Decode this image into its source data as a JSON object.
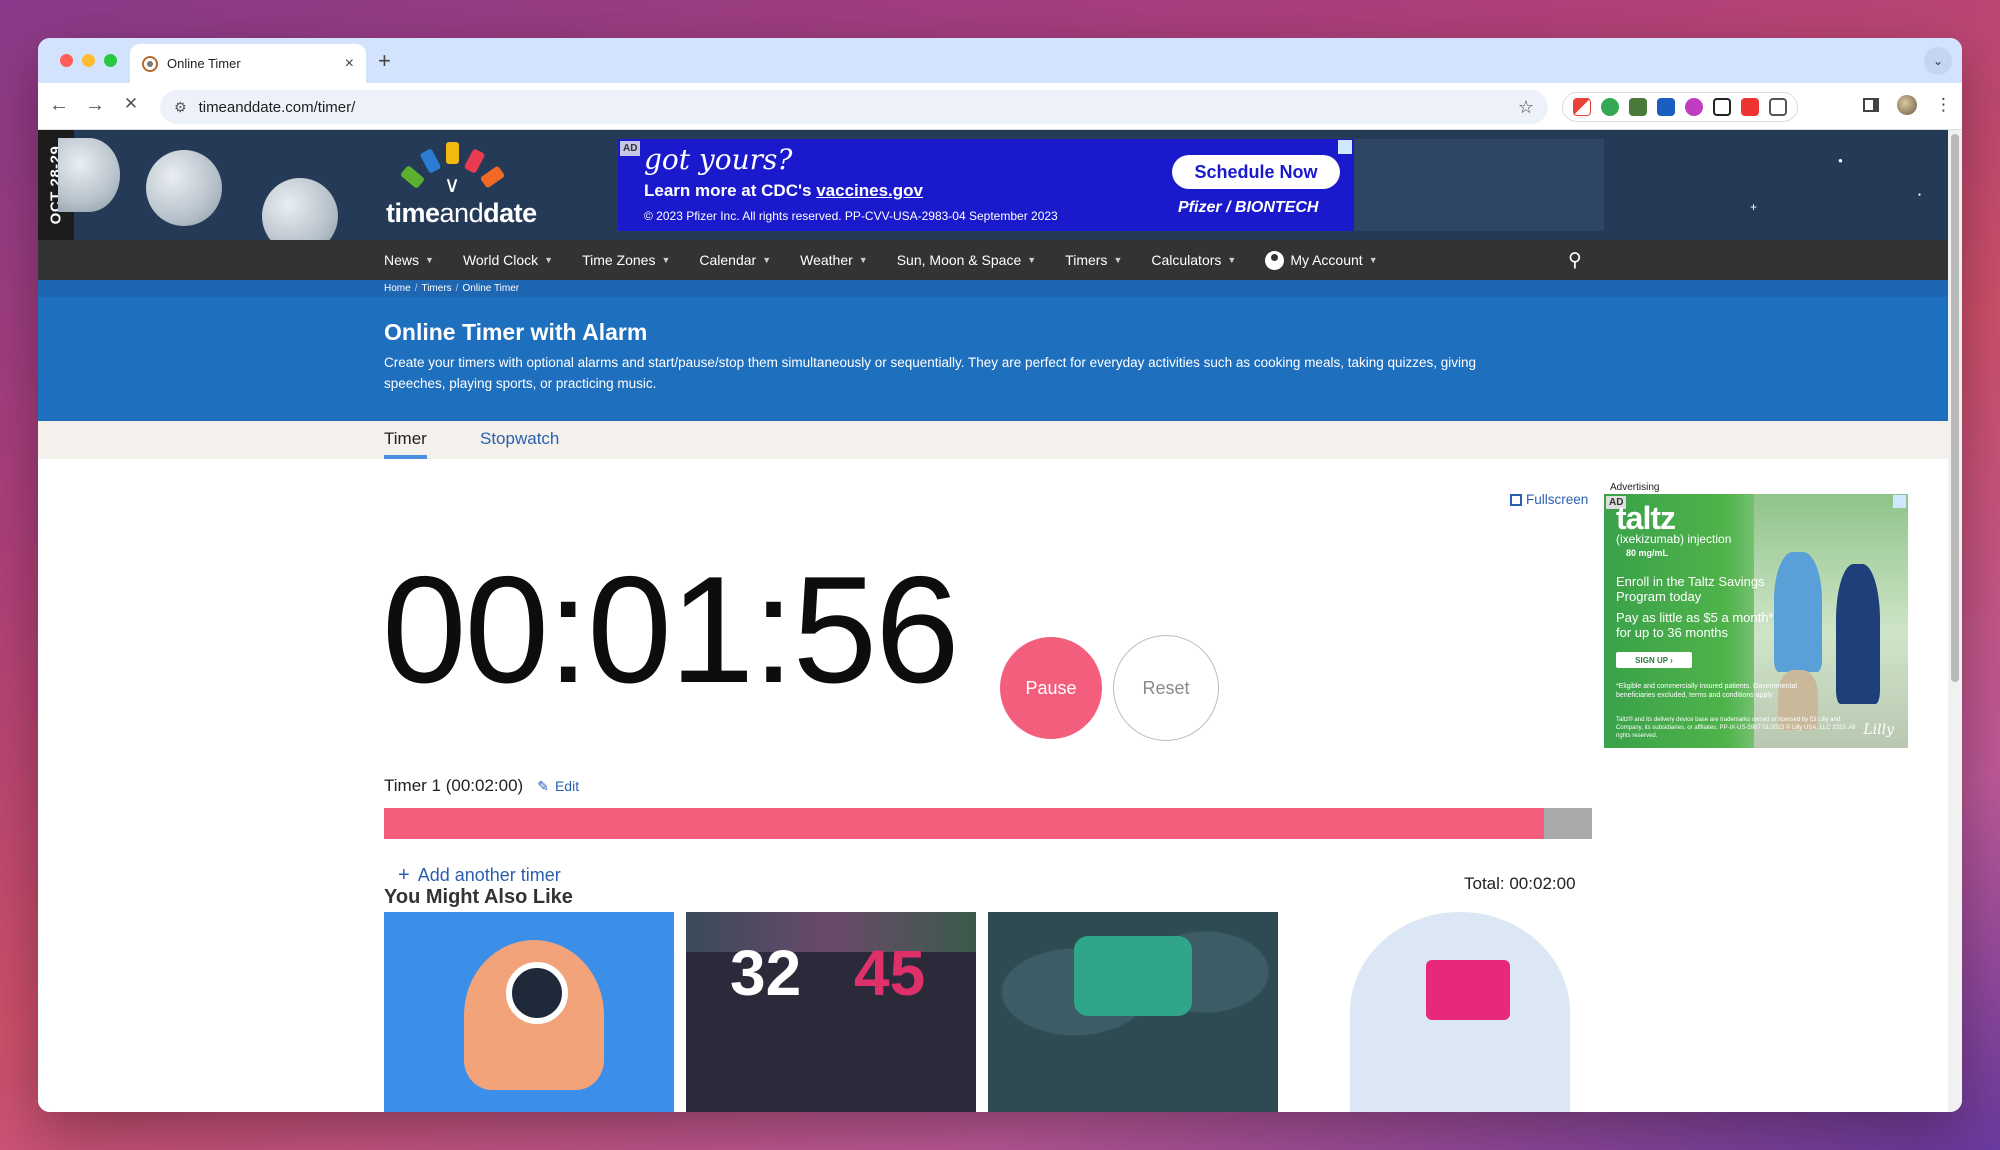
{
  "browser": {
    "tab_title": "Online Timer",
    "tab_close": "×",
    "new_tab": "+",
    "url": "timeanddate.com/timer/",
    "back": "←",
    "forward": "→",
    "stop": "✕",
    "star": "☆",
    "menu": "⋮",
    "tab_menu": "⌄",
    "traffic_colors": [
      "#ff5f57",
      "#febc2e",
      "#28c840"
    ],
    "extension_icons": [
      "gmail-icon",
      "extension-badge-icon",
      "sheets-extension-icon",
      "tab-extension-icon",
      "purple-extension-icon",
      "notion-icon",
      "stack-extension-icon",
      "puzzle-icon"
    ]
  },
  "banner": {
    "date_strip": "OCT 28-29",
    "logo_text_bold": "time",
    "logo_text_light": "and",
    "logo_text_end": "date",
    "ad": {
      "tag": "AD",
      "headline": "got yours?",
      "line2_pre": "Learn more at CDC's ",
      "line2_link": "vaccines.gov",
      "line3": "© 2023 Pfizer Inc. All rights reserved. PP-CVV-USA-2983-04 September 2023",
      "cta": "Schedule Now",
      "brand": "Pfizer / BIONTECH",
      "background": "#1a1acc"
    }
  },
  "nav": {
    "items": [
      {
        "label": "News"
      },
      {
        "label": "World Clock"
      },
      {
        "label": "Time Zones"
      },
      {
        "label": "Calendar"
      },
      {
        "label": "Weather"
      },
      {
        "label": "Sun, Moon & Space"
      },
      {
        "label": "Timers"
      },
      {
        "label": "Calculators"
      },
      {
        "label": "My Account"
      }
    ]
  },
  "breadcrumb": [
    "Home",
    "Timers",
    "Online Timer"
  ],
  "hero": {
    "title": "Online Timer with Alarm",
    "description": "Create your timers with optional alarms and start/pause/stop them simultaneously or sequentially. They are perfect for everyday activities such as cooking meals, taking quizzes, giving speeches, playing sports, or practicing music."
  },
  "subtabs": {
    "active": "Timer",
    "inactive": "Stopwatch"
  },
  "timer": {
    "fullscreen_label": "Fullscreen",
    "display": "00:01:56",
    "pause_label": "Pause",
    "reset_label": "Reset",
    "name": "Timer 1 (00:02:00)",
    "edit_label": "Edit",
    "progress_fraction": 0.96,
    "progress_color": "#f25e7c",
    "add_label": "Add another timer",
    "total_label": "Total: 00:02:00"
  },
  "side_ad": {
    "label": "Advertising",
    "tag": "AD",
    "brand": "taltz",
    "sub": "(ixekizumab) injection",
    "dose": "80 mg/mL",
    "line1": "Enroll in the Taltz Savings Program today",
    "line2": "Pay as little as $5 a month* for up to 36 months",
    "signup": "SIGN UP ›",
    "fine1": "*Eligible and commercially insured patients. Governmental beneficiaries excluded, terms and conditions apply.",
    "fine2": "Taltz® and its delivery device base are trademarks owned or licensed by Eli Lilly and Company, its subsidiaries, or affiliates. PP-IX-US-5967 01/2023 © Lilly USA, LLC 2023. All rights reserved.",
    "maker": "Lilly"
  },
  "more": {
    "title": "You Might Also Like",
    "card2_digits": [
      "32",
      "45"
    ]
  },
  "colors": {
    "accent": "#1e6fbe",
    "nav_bg": "#333333",
    "pink": "#f25e7c"
  }
}
